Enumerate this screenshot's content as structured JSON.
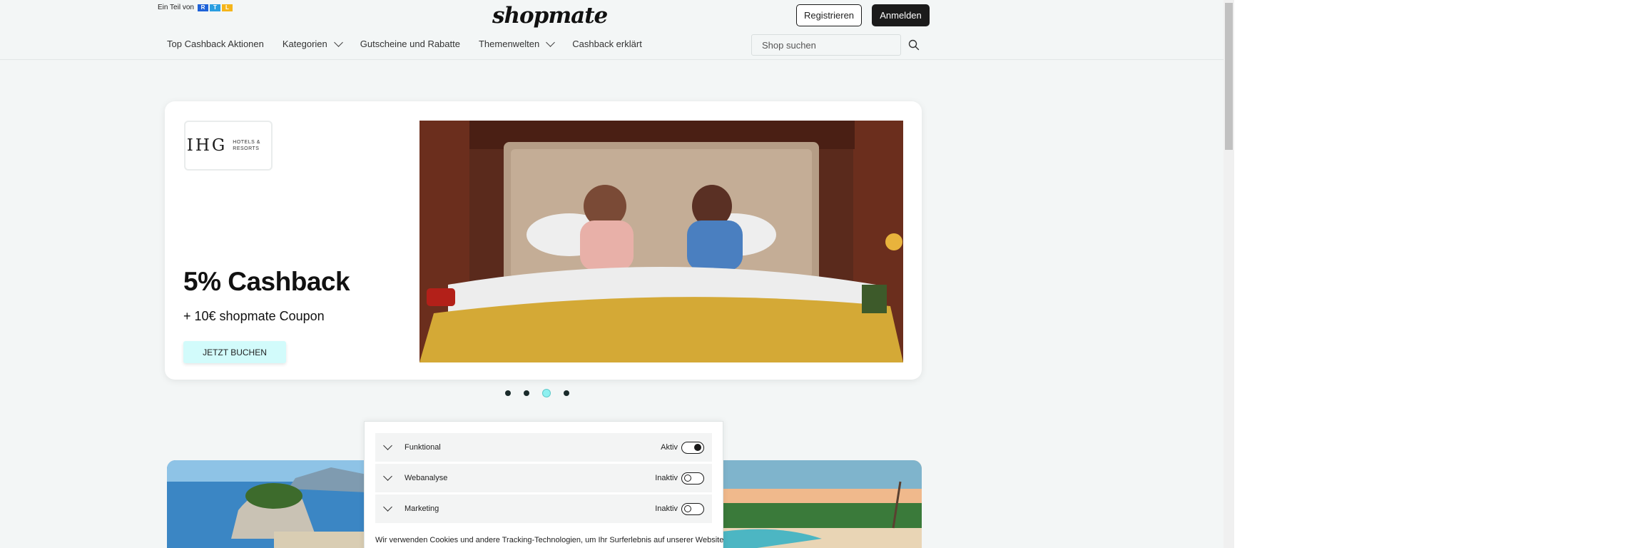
{
  "header": {
    "rtl_prefix": "Ein Teil von",
    "rtl_letters": [
      "R",
      "T",
      "L"
    ],
    "logo": "shopmate",
    "register_label": "Registrieren",
    "login_label": "Anmelden"
  },
  "nav": {
    "items": [
      {
        "label": "Top Cashback Aktionen",
        "dropdown": false
      },
      {
        "label": "Kategorien",
        "dropdown": true
      },
      {
        "label": "Gutscheine und Rabatte",
        "dropdown": false
      },
      {
        "label": "Themenwelten",
        "dropdown": true
      },
      {
        "label": "Cashback erklärt",
        "dropdown": false
      }
    ],
    "search_placeholder": "Shop suchen"
  },
  "hero": {
    "brand_name": "IHG",
    "brand_sub": "HOTELS & RESORTS",
    "title": "5% Cashback",
    "subtitle": "+ 10€ shopmate Coupon",
    "cta_label": "JETZT BUCHEN",
    "slide_count": 4,
    "active_slide": 3
  },
  "cookies": {
    "rows": [
      {
        "label": "Funktional",
        "status": "Aktiv",
        "on": true
      },
      {
        "label": "Webanalyse",
        "status": "Inaktiv",
        "on": false
      },
      {
        "label": "Marketing",
        "status": "Inaktiv",
        "on": false
      }
    ],
    "text": "Wir verwenden Cookies und andere Tracking-Technologien, um Ihr Surferlebnis auf unserer Website"
  },
  "colors": {
    "page_bg": "#f3f6f6",
    "accent_cyan": "#d2fbfb",
    "dark": "#1b1b1b"
  }
}
